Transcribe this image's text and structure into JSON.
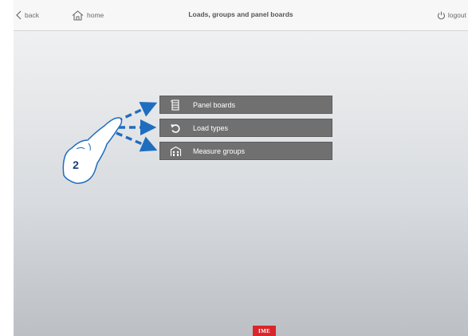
{
  "header": {
    "back_label": "back",
    "home_label": "home",
    "title": "Loads, groups and panel boards",
    "logout_label": "logout"
  },
  "menu": {
    "items": [
      {
        "label": "Panel boards",
        "icon": "panel-board-icon"
      },
      {
        "label": "Load types",
        "icon": "undo-arrow-icon"
      },
      {
        "label": "Measure groups",
        "icon": "measure-group-icon"
      }
    ]
  },
  "annotation": {
    "step_number": "2",
    "hand_icon": "pointing-hand-icon",
    "arrow_color": "#1f6dbf"
  },
  "footer": {
    "logo_text": "IME",
    "logo_color": "#d9262a"
  },
  "colors": {
    "menu_button_bg": "#707070",
    "background_top": "#f3f4f5",
    "background_bottom": "#bcc0c4"
  }
}
